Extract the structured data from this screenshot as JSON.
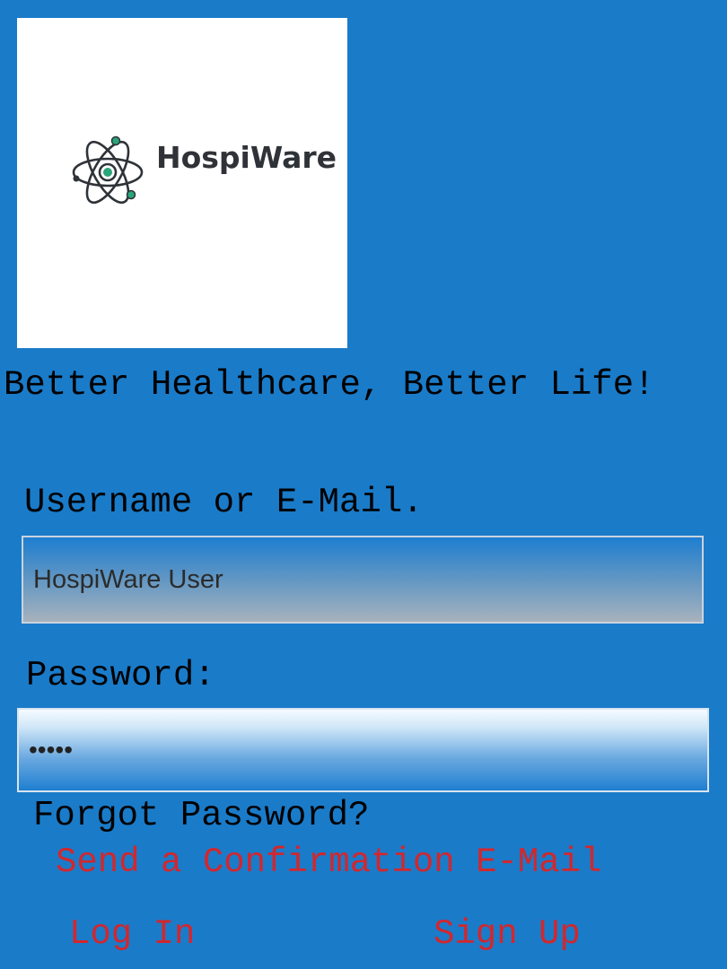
{
  "logo": {
    "brand_name": "HospiWare",
    "icon": "atom-icon",
    "colors": {
      "text": "#2f3338",
      "accent": "#2aa579",
      "outline": "#2f3338"
    }
  },
  "tagline": "Better Healthcare, Better Life!",
  "form": {
    "username_label": "Username or E-Mail.",
    "username_value": "HospiWare User",
    "password_label": "Password:",
    "password_value": "•••••",
    "forgot_label": "Forgot Password?",
    "send_confirmation_link": "Send a Confirmation E-Mail"
  },
  "actions": {
    "login_label": "Log In",
    "signup_label": "Sign Up"
  },
  "colors": {
    "background": "#1a7bc9",
    "link": "#d2272d",
    "label": "#000000"
  }
}
